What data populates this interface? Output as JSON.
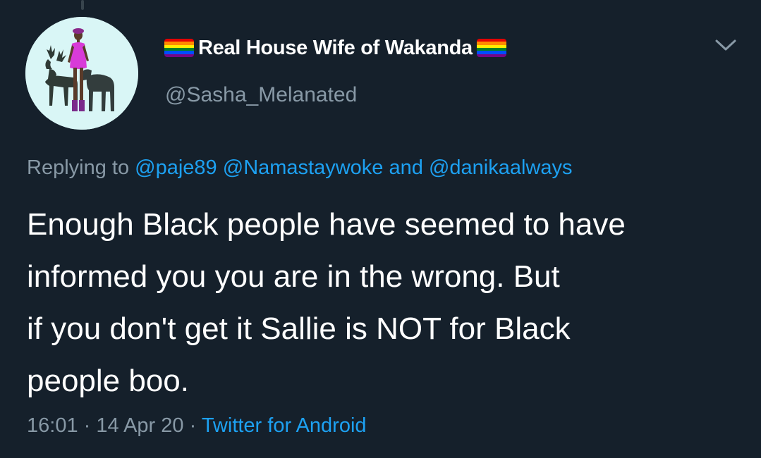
{
  "author": {
    "display_name": "Real House Wife of Wakanda",
    "handle": "@Sasha_Melanated"
  },
  "reply": {
    "prefix": "Replying to",
    "mentions": [
      "@paje89",
      "@Namastaywoke",
      "@danikaalways"
    ],
    "conjunction": "and"
  },
  "tweet": {
    "lines": [
      "Enough Black people have seemed to have",
      "informed you you are in the wrong. But",
      "if you don't get it Sallie is NOT for Black",
      "people boo."
    ]
  },
  "meta": {
    "time": "16:01",
    "separator": "·",
    "date": "14 Apr 20",
    "source": "Twitter for Android"
  },
  "icons": {
    "menu": "chevron-down-icon",
    "flag": "rainbow-flag-icon"
  },
  "colors": {
    "background": "#15202b",
    "text": "#ffffff",
    "secondary": "#8899a6",
    "link": "#1da1f2"
  }
}
